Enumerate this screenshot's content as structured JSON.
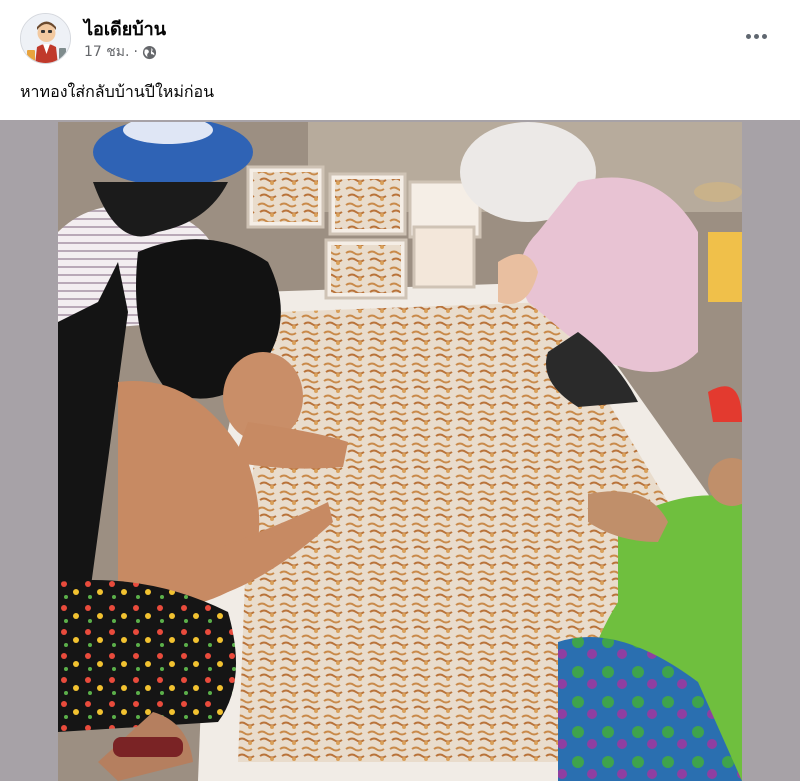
{
  "post": {
    "page_name": "ไอเดียบ้าน",
    "time": "17 ชม.",
    "separator": "·",
    "privacy_icon": "globe-icon",
    "more_icon": "more-dots-icon",
    "text": "หาทองใส่กลับบ้านปีใหม่ก่อน"
  },
  "colors": {
    "name": "#050505",
    "meta": "#65676b",
    "media_backdrop": "#a7a2a7"
  }
}
